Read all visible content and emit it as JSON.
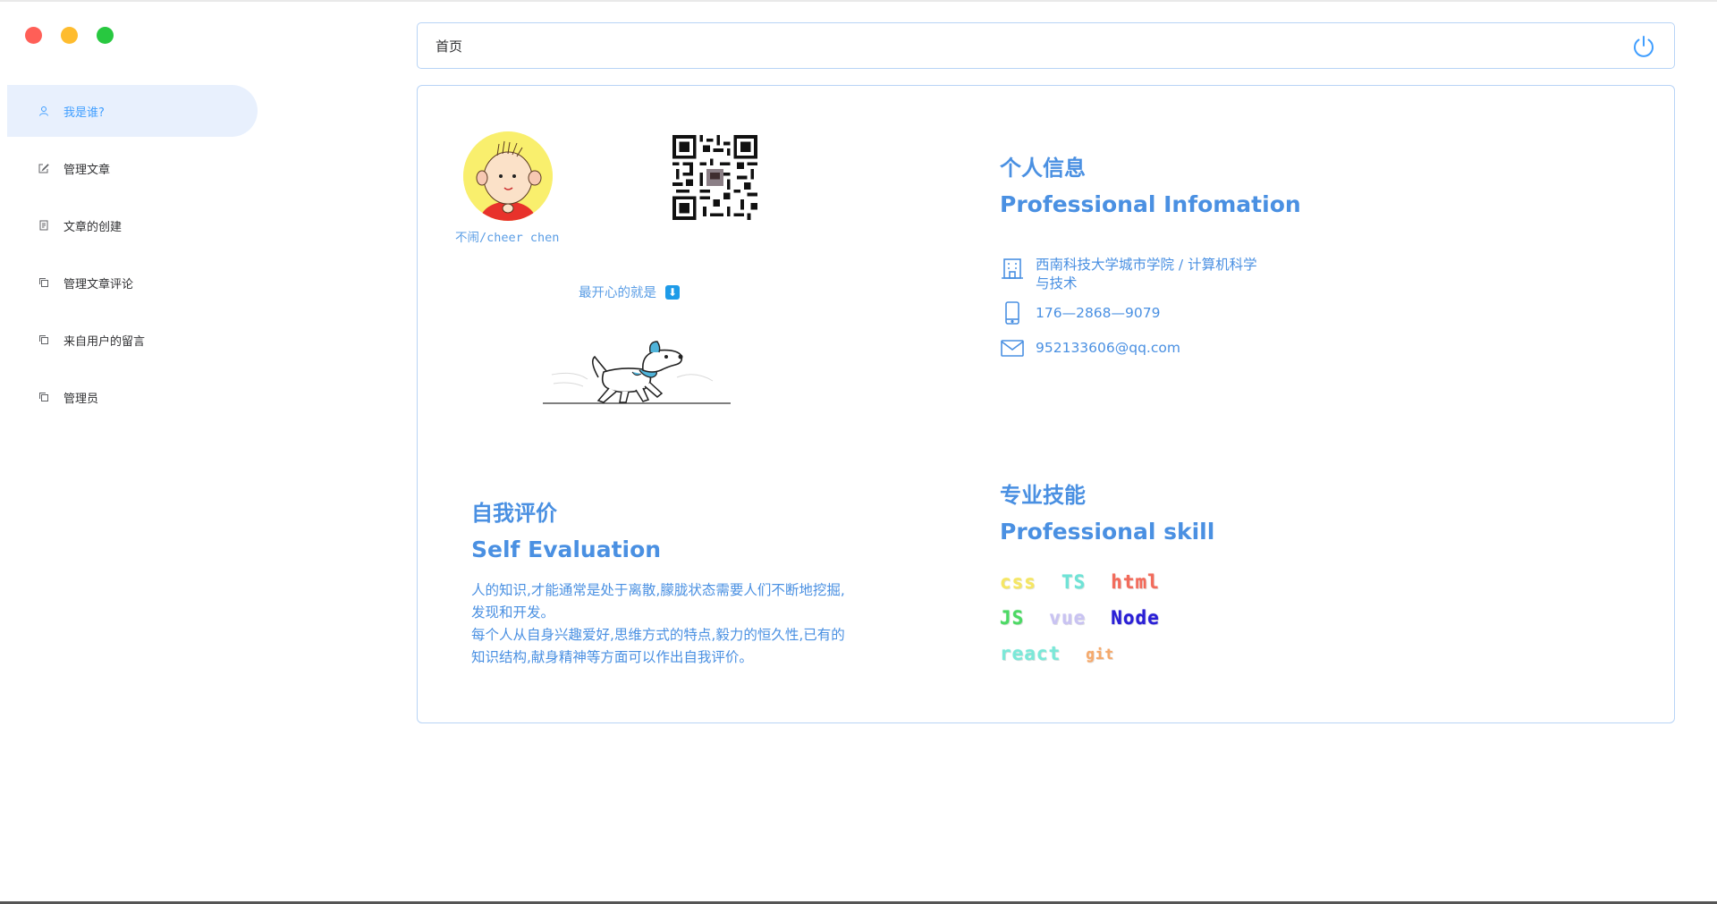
{
  "window": {
    "controls": [
      {
        "name": "close",
        "color": "#ff5f57"
      },
      {
        "name": "minimize",
        "color": "#febc2e"
      },
      {
        "name": "maximize",
        "color": "#28c840"
      }
    ]
  },
  "sidebar": {
    "items": [
      {
        "label": "我是谁?",
        "icon": "user-icon",
        "active": true
      },
      {
        "label": "管理文章",
        "icon": "edit-icon",
        "active": false
      },
      {
        "label": "文章的创建",
        "icon": "document-icon",
        "active": false
      },
      {
        "label": "管理文章评论",
        "icon": "copy-icon",
        "active": false
      },
      {
        "label": "来自用户的留言",
        "icon": "copy-icon",
        "active": false
      },
      {
        "label": "管理员",
        "icon": "copy-icon",
        "active": false
      }
    ]
  },
  "header": {
    "breadcrumb": "首页",
    "power_icon": "power-icon"
  },
  "profile": {
    "name": "不闹/cheer chen",
    "happy_text": "最开心的就是",
    "happy_emoji": "⬇"
  },
  "personal": {
    "title_cn": "个人信息",
    "title_en": "Professional Infomation",
    "school_line1": "西南科技大学城市学院 / 计算机科学",
    "school_line2": "与技术",
    "phone": "176—2868—9079",
    "email": "952133606@qq.com"
  },
  "evaluation": {
    "title_cn": "自我评价",
    "title_en": "Self Evaluation",
    "lines": [
      "人的知识,才能通常是处于离散,朦胧状态需要人们不断地挖掘,",
      "发现和开发。",
      "每个人从自身兴趣爱好,思维方式的特点,毅力的恒久性,已有的",
      "知识结构,献身精神等方面可以作出自我评价。"
    ]
  },
  "skills": {
    "title_cn": "专业技能",
    "title_en": "Professional skill",
    "rows": [
      [
        {
          "label": "css",
          "color": "#f5e663"
        },
        {
          "label": "TS",
          "color": "#6fe3d6"
        },
        {
          "label": "html",
          "color": "#f26b5b"
        }
      ],
      [
        {
          "label": "JS",
          "color": "#4cd964"
        },
        {
          "label": "vue",
          "color": "#c9c3f2"
        },
        {
          "label": "Node",
          "color": "#2a1fd6"
        }
      ],
      [
        {
          "label": "react",
          "color": "#7be8d8"
        },
        {
          "label": "git",
          "color": "#f5a96b"
        }
      ]
    ]
  },
  "colors": {
    "accent": "#409eff",
    "text_blue": "#4a90e2",
    "active_bg": "#e8f0fd",
    "border": "#b8d4f6"
  }
}
